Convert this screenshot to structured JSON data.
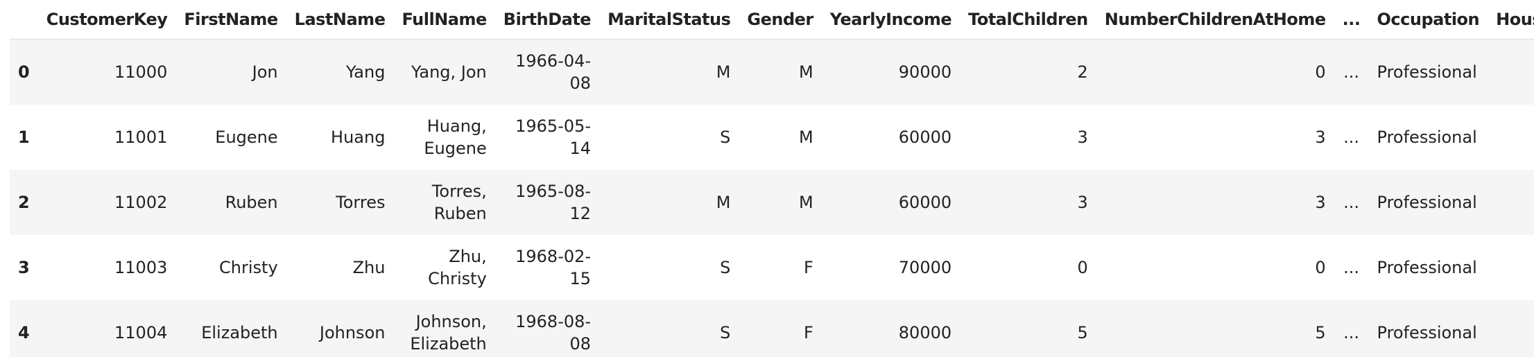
{
  "table": {
    "columns": [
      "",
      "CustomerKey",
      "FirstName",
      "LastName",
      "FullName",
      "BirthDate",
      "MaritalStatus",
      "Gender",
      "YearlyIncome",
      "TotalChildren",
      "NumberChildrenAtHome",
      "...",
      "Occupation",
      "HouseOwn"
    ],
    "rows": [
      [
        "0",
        "11000",
        "Jon",
        "Yang",
        "Yang, Jon",
        "1966-04-08",
        "M",
        "M",
        "90000",
        "2",
        "0",
        "...",
        "Professional",
        ""
      ],
      [
        "1",
        "11001",
        "Eugene",
        "Huang",
        "Huang, Eugene",
        "1965-05-14",
        "S",
        "M",
        "60000",
        "3",
        "3",
        "...",
        "Professional",
        ""
      ],
      [
        "2",
        "11002",
        "Ruben",
        "Torres",
        "Torres, Ruben",
        "1965-08-12",
        "M",
        "M",
        "60000",
        "3",
        "3",
        "...",
        "Professional",
        ""
      ],
      [
        "3",
        "11003",
        "Christy",
        "Zhu",
        "Zhu, Christy",
        "1968-02-15",
        "S",
        "F",
        "70000",
        "0",
        "0",
        "...",
        "Professional",
        ""
      ],
      [
        "4",
        "11004",
        "Elizabeth",
        "Johnson",
        "Johnson, Elizabeth",
        "1968-08-08",
        "S",
        "F",
        "80000",
        "5",
        "5",
        "...",
        "Professional",
        ""
      ]
    ]
  }
}
